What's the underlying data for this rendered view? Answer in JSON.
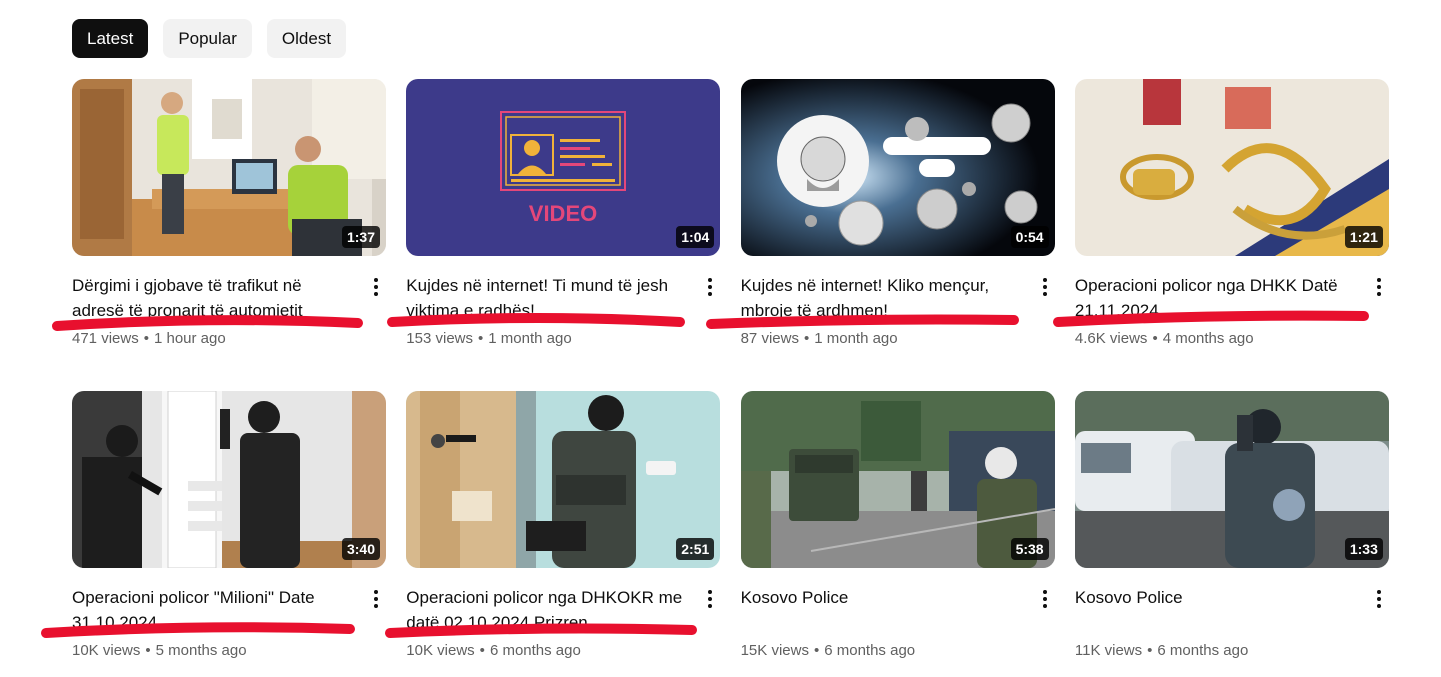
{
  "filters": {
    "latest": "Latest",
    "popular": "Popular",
    "oldest": "Oldest"
  },
  "videos": [
    {
      "title": "Dërgimi i gjobave të trafikut në adresë të pronarit të automjetit",
      "views": "471 views",
      "age": "1 hour ago",
      "duration": "1:37"
    },
    {
      "title": "Kujdes në internet! Ti mund të jesh viktima e radhës!",
      "views": "153 views",
      "age": "1 month ago",
      "duration": "1:04",
      "thumb_text": "VIDEO"
    },
    {
      "title": "Kujdes në internet! Kliko mençur, mbroje të ardhmen!",
      "views": "87 views",
      "age": "1 month ago",
      "duration": "0:54"
    },
    {
      "title": "Operacioni policor nga DHKK Datë 21.11.2024",
      "views": "4.6K views",
      "age": "4 months ago",
      "duration": "1:21"
    },
    {
      "title": "Operacioni policor \"Milioni\" Date 31.10.2024",
      "views": "10K views",
      "age": "5 months ago",
      "duration": "3:40"
    },
    {
      "title": "Operacioni policor nga DHKOKR me datë 02.10.2024 Prizren",
      "views": "10K views",
      "age": "6 months ago",
      "duration": "2:51"
    },
    {
      "title": "Kosovo Police",
      "views": "15K views",
      "age": "6 months ago",
      "duration": "5:38"
    },
    {
      "title": "Kosovo Police",
      "views": "11K views",
      "age": "6 months ago",
      "duration": "1:33"
    }
  ],
  "separator": "•",
  "colors": {
    "annotation_red": "#e8102e",
    "chip_active": "#0f0f0f",
    "chip_bg": "#f2f2f2",
    "meta_text": "#606060"
  }
}
